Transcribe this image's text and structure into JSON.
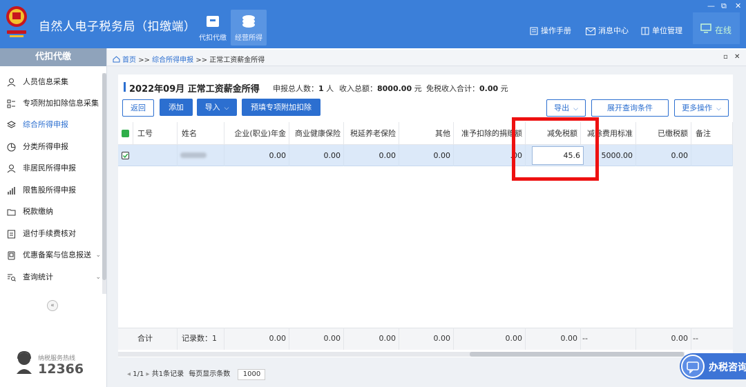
{
  "app": {
    "title": "自然人电子税务局（扣缴端）",
    "nav_tabs": [
      {
        "label": "代扣代缴",
        "icon": "briefcase-icon"
      },
      {
        "label": "经营所得",
        "icon": "coins-icon",
        "active": true
      }
    ],
    "top_links": [
      {
        "label": "操作手册",
        "icon": "manual-icon"
      },
      {
        "label": "消息中心",
        "icon": "mail-icon"
      },
      {
        "label": "单位管理",
        "icon": "building-icon"
      }
    ],
    "status": {
      "label": "在线",
      "icon": "monitor-icon"
    },
    "accent_color": "#3b7fd9",
    "window_controls": [
      "—",
      "⧉",
      "✕"
    ]
  },
  "sidebar": {
    "header": "代扣代缴",
    "items": [
      {
        "label": "人员信息采集",
        "icon": "person-icon"
      },
      {
        "label": "专项附加扣除信息采集",
        "icon": "list-icon"
      },
      {
        "label": "综合所得申报",
        "icon": "layers-icon",
        "active": true
      },
      {
        "label": "分类所得申报",
        "icon": "pie-icon"
      },
      {
        "label": "非居民所得申报",
        "icon": "person-icon"
      },
      {
        "label": "限售股所得申报",
        "icon": "bar-chart-icon"
      },
      {
        "label": "税款缴纳",
        "icon": "folder-icon"
      },
      {
        "label": "退付手续费核对",
        "icon": "doc-icon"
      },
      {
        "label": "优惠备案与信息报送",
        "icon": "file-icon",
        "chevron": "⌄"
      },
      {
        "label": "查询统计",
        "icon": "search-list-icon",
        "chevron": "⌄"
      }
    ],
    "collapse_symbol": "«",
    "hotline_label": "纳税服务热线",
    "hotline_number": "12366"
  },
  "breadcrumb": {
    "home": "首页",
    "sep": ">>",
    "parent": "综合所得申报",
    "current": "正常工资薪金所得",
    "controls": [
      "▫",
      "✕"
    ]
  },
  "summary": {
    "title": "2022年09月 正常工资薪金所得",
    "count_label": "申报总人数：",
    "count_value": "1",
    "count_unit": "人",
    "income_label": "收入总额：",
    "income_value": "8000.00",
    "income_unit": "元",
    "taxfree_label": "免税收入合计：",
    "taxfree_value": "0.00",
    "taxfree_unit": "元"
  },
  "toolbar": {
    "back": "返回",
    "add": "添加",
    "import": "导入",
    "prefill": "预填专项附加扣除",
    "export": "导出",
    "expand_query": "展开查询条件",
    "more": "更多操作",
    "caret": "⌵"
  },
  "table": {
    "headers": [
      "工号",
      "姓名",
      "企业(职业)年金",
      "商业健康保险",
      "税延养老保险",
      "其他",
      "准予扣除的捐赠额",
      "减免税额",
      "减除费用标准",
      "已缴税额",
      "备注"
    ],
    "row": {
      "checked": true,
      "id": "",
      "name": "",
      "annuity": "0.00",
      "health": "0.00",
      "pension": "0.00",
      "other": "0.00",
      "donation": ".00",
      "tax_reduction": "45.6",
      "deduction_std": "5000.00",
      "paid_tax": "0.00",
      "remark": ""
    },
    "footer": {
      "label": "合计",
      "record_count": "记录数：1",
      "annuity": "0.00",
      "health": "0.00",
      "pension": "0.00",
      "other": "0.00",
      "donation": "0.00",
      "tax_reduction": "0.00",
      "deduction_std": "--",
      "paid_tax": "0.00",
      "remark": "--"
    }
  },
  "pager": {
    "page": "1/1",
    "total": "共1条记录",
    "per_page_label": "每页显示条数",
    "per_page": "1000"
  },
  "consult": {
    "label": "办税咨询"
  }
}
